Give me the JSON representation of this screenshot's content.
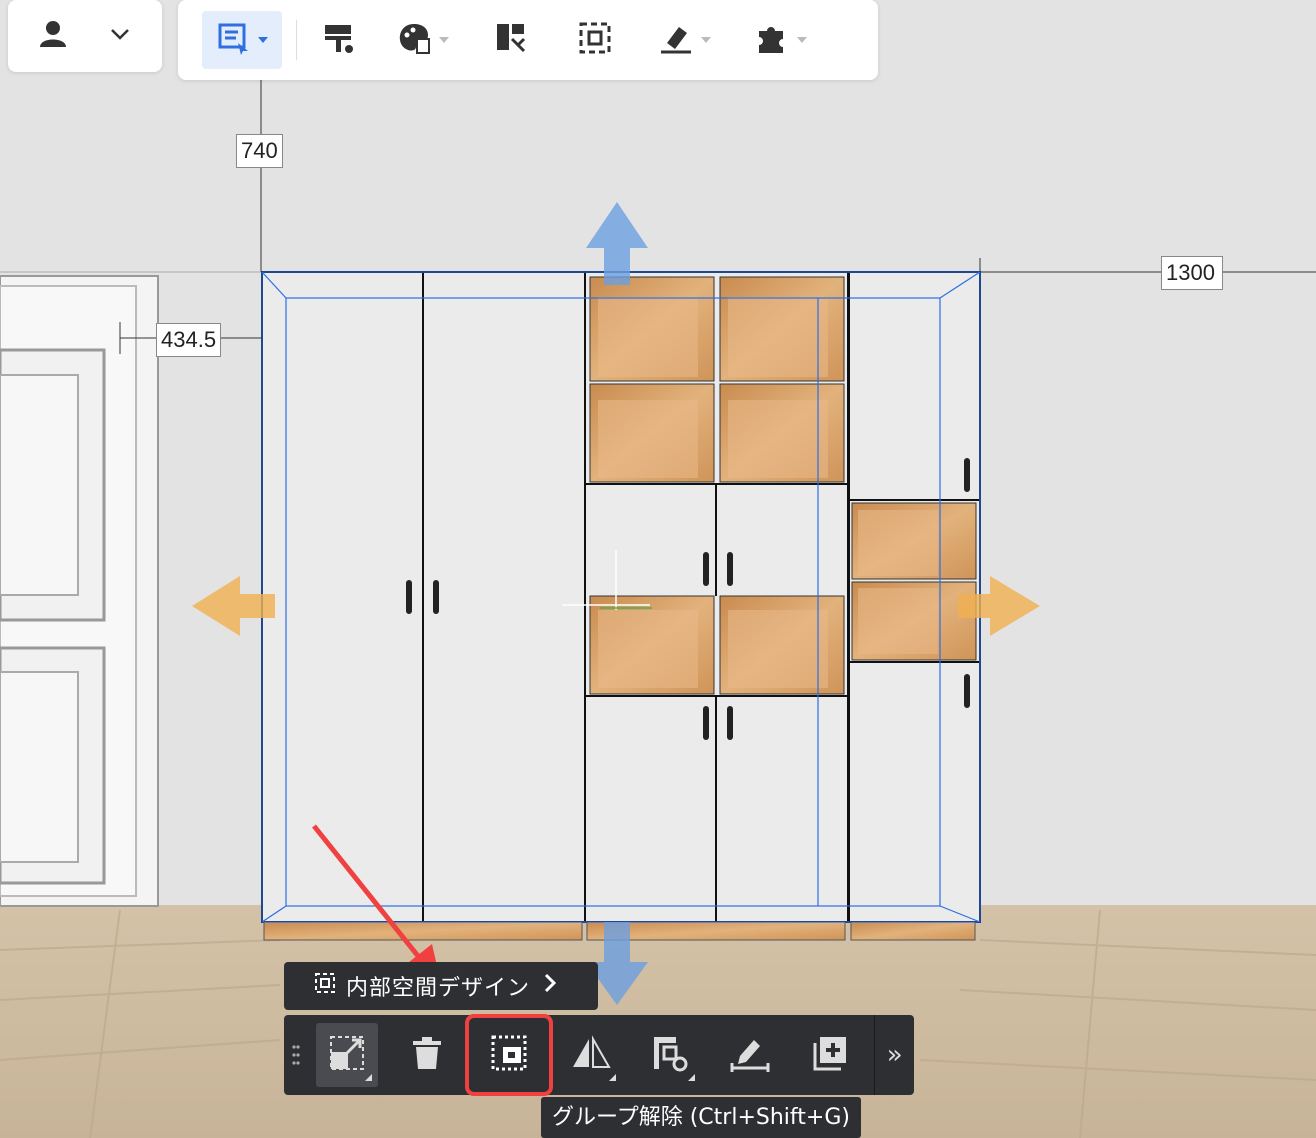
{
  "toolbar_top": {
    "user_icon": "user-icon",
    "items": [
      {
        "name": "select-mode",
        "icon": "select-list-icon",
        "active": true
      },
      {
        "name": "paint",
        "icon": "paint-roller-icon"
      },
      {
        "name": "material",
        "icon": "palette-icon"
      },
      {
        "name": "split",
        "icon": "split-panel-icon"
      },
      {
        "name": "frame",
        "icon": "frame-select-icon"
      },
      {
        "name": "measure",
        "icon": "brush-icon"
      },
      {
        "name": "plugin",
        "icon": "puzzle-icon"
      }
    ]
  },
  "dimensions": {
    "height_label": "740",
    "offset_label": "434.5",
    "width_label": "1300"
  },
  "space_design": {
    "label": "内部空間デザイン",
    "icon": "frame-icon"
  },
  "bottom_bar": {
    "buttons": [
      {
        "name": "scale",
        "icon": "scale-icon",
        "selected": true
      },
      {
        "name": "delete",
        "icon": "trash-icon"
      },
      {
        "name": "ungroup",
        "icon": "ungroup-icon",
        "highlight": true
      },
      {
        "name": "mirror",
        "icon": "mirror-icon"
      },
      {
        "name": "align",
        "icon": "align-settings-icon"
      },
      {
        "name": "edit-measure",
        "icon": "edit-ruler-icon"
      },
      {
        "name": "duplicate",
        "icon": "duplicate-icon"
      }
    ],
    "more_label": "»"
  },
  "tooltip": {
    "text": "グループ解除 (Ctrl+Shift+G)"
  },
  "colors": {
    "accent": "#2f6fe0",
    "highlight_red": "#f04040",
    "wood": "#d9a36a",
    "arrow_blue": "#6c9fe0",
    "arrow_orange": "#f0b050"
  }
}
